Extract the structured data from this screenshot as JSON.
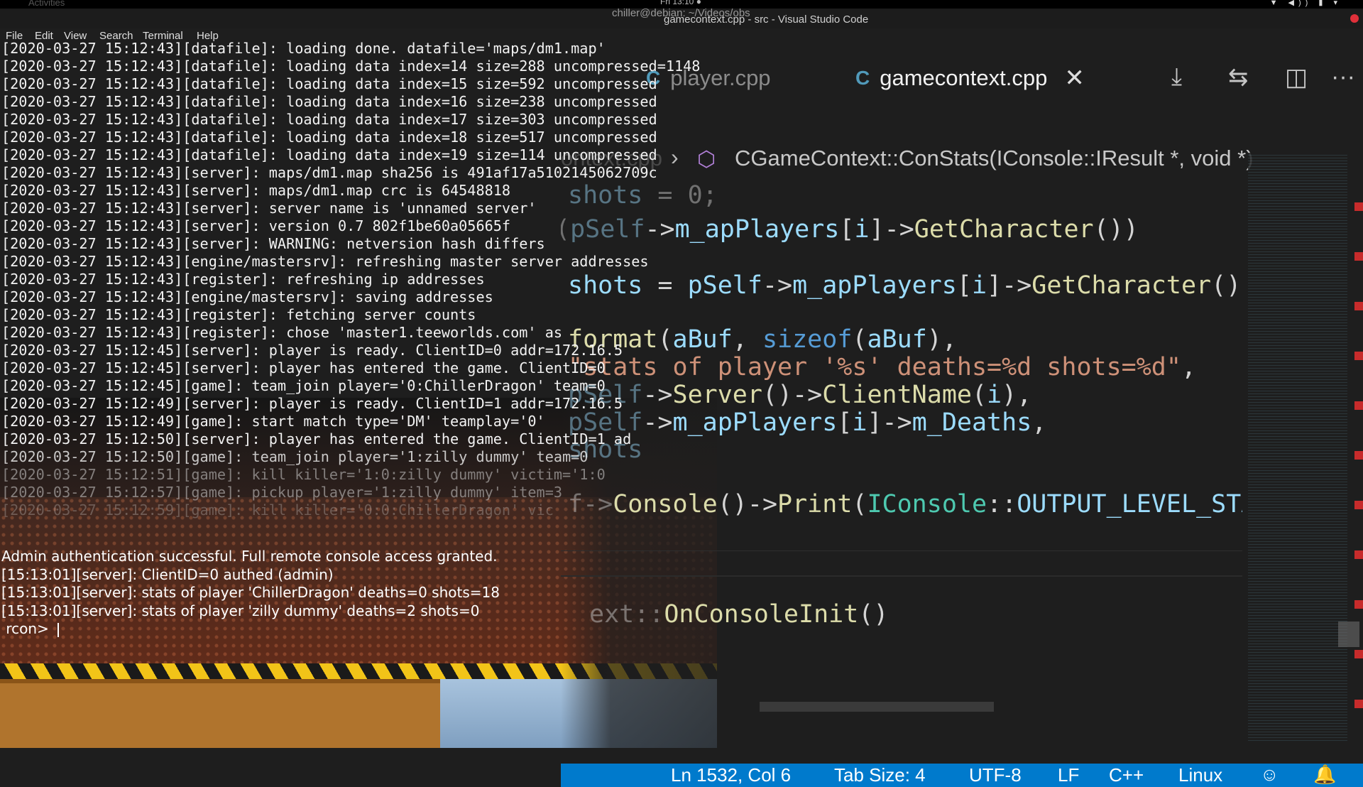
{
  "system_bar": {
    "activities": "Activities",
    "clock": "Fri 13:10 ●",
    "tray": "▼ ◀)) ▮ ▾"
  },
  "terminal": {
    "title": "chiller@debian: ~/Videos/obs",
    "menu": [
      "File",
      "Edit",
      "View",
      "Search",
      "Terminal",
      "Help"
    ],
    "log": [
      "[2020-03-27 15:12:43][datafile]: loading done. datafile='maps/dm1.map'",
      "[2020-03-27 15:12:43][datafile]: loading data index=14 size=288 uncompressed=1148",
      "[2020-03-27 15:12:43][datafile]: loading data index=15 size=592 uncompressed",
      "[2020-03-27 15:12:43][datafile]: loading data index=16 size=238 uncompressed",
      "[2020-03-27 15:12:43][datafile]: loading data index=17 size=303 uncompressed",
      "[2020-03-27 15:12:43][datafile]: loading data index=18 size=517 uncompressed",
      "[2020-03-27 15:12:43][datafile]: loading data index=19 size=114 uncompressed",
      "[2020-03-27 15:12:43][server]: maps/dm1.map sha256 is 491af17a5102145062709c",
      "[2020-03-27 15:12:43][server]: maps/dm1.map crc is 64548818",
      "[2020-03-27 15:12:43][server]: server name is 'unnamed server'",
      "[2020-03-27 15:12:43][server]: version 0.7 802f1be60a05665f",
      "[2020-03-27 15:12:43][server]: WARNING: netversion hash differs",
      "[2020-03-27 15:12:43][engine/mastersrv]: refreshing master server addresses",
      "[2020-03-27 15:12:43][register]: refreshing ip addresses",
      "[2020-03-27 15:12:43][engine/mastersrv]: saving addresses",
      "[2020-03-27 15:12:43][register]: fetching server counts",
      "[2020-03-27 15:12:43][register]: chose 'master1.teeworlds.com' as",
      "[2020-03-27 15:12:45][server]: player is ready. ClientID=0 addr=172.16.5",
      "[2020-03-27 15:12:45][server]: player has entered the game. ClientID=0",
      "[2020-03-27 15:12:45][game]: team_join player='0:ChillerDragon' team=0",
      "[2020-03-27 15:12:49][server]: player is ready. ClientID=1 addr=172.16.5",
      "[2020-03-27 15:12:49][game]: start match type='DM' teamplay='0'",
      "[2020-03-27 15:12:50][server]: player has entered the game. ClientID=1 ad",
      "[2020-03-27 15:12:50][game]: team_join player='1:zilly dummy' team=0",
      "[2020-03-27 15:12:51][game]: kill killer='1:0:zilly dummy' victim='1:0",
      "[2020-03-27 15:12:57][game]: pickup player='1:zilly dummy' item=3",
      "[2020-03-27 15:12:59][game]: kill killer='0:0:ChillerDragon' vic"
    ],
    "rcon": [
      "Admin authentication successful. Full remote console access granted.",
      "[15:13:01][server]: ClientID=0 authed (admin)",
      "[15:13:01][server]: stats of player 'ChillerDragon' deaths=0 shots=18",
      "[15:13:01][server]: stats of player 'zilly dummy' deaths=2 shots=0"
    ],
    "rcon_prompt": " rcon> "
  },
  "vscode": {
    "title": "gamecontext.cpp - src - Visual Studio Code",
    "tabs": [
      {
        "label": "player.cpp",
        "icon": "cpp-icon",
        "active": false
      },
      {
        "label": "gamecontext.cpp",
        "icon": "cpp-icon",
        "active": true
      }
    ],
    "cpp_icon_glyph": "C",
    "tab_close_glyph": "✕",
    "actions": [
      "open-changes-icon",
      "git-compare-icon",
      "split-editor-icon",
      "more-actions-icon"
    ],
    "action_glyphs": [
      "⤓",
      "⇆",
      "◫",
      "···"
    ],
    "breadcrumb": {
      "file": "ontext.cpp",
      "separator": "›",
      "symbol_icon": "⬡",
      "symbol": "CGameContext::ConStats(IConsole::IResult *, void *)"
    },
    "code": {
      "l1_var": "shots",
      "l1_rest": " = 0;",
      "l2_open": "(",
      "l2_obj": "pSelf",
      "l2_arrow": "->",
      "l2_member": "m_apPlayers",
      "l2_idx_open": "[",
      "l2_idx": "i",
      "l2_idx_close": "]->",
      "l2_fn": "GetCharacter",
      "l2_close": "())",
      "l3_var": "shots",
      "l3_eq": " = ",
      "l3_obj": "pSelf",
      "l3_arrow": "->",
      "l3_member": "m_apPlayers",
      "l3_idx_open": "[",
      "l3_idx": "i",
      "l3_idx_close": "]->",
      "l3_fn": "GetCharacter",
      "l3_close": "()",
      "l4_fn": "format",
      "l4_open": "(",
      "l4_arg1": "aBuf",
      "l4_sep": ", ",
      "l4_kw": "sizeof",
      "l4_open2": "(",
      "l4_arg2": "aBuf",
      "l4_close": "),",
      "l5_str": "\"stats of player '%s' deaths=%d shots=%d\"",
      "l5_comma": ",",
      "l6_obj": "pSelf",
      "l6_arrow": "->",
      "l6_fn": "Server",
      "l6_mid": "()->",
      "l6_fn2": "ClientName",
      "l6_open": "(",
      "l6_arg": "i",
      "l6_close": "),",
      "l7_obj": "pSelf",
      "l7_arrow": "->",
      "l7_member": "m_apPlayers",
      "l7_idx_open": "[",
      "l7_idx": "i",
      "l7_idx_close": "]->",
      "l7_member2": "m_Deaths",
      "l7_comma": ",",
      "l8_var": "shots",
      "l9_prefix": "f->",
      "l9_fn": "Console",
      "l9_mid": "()->",
      "l9_fn2": "Print",
      "l9_open": "(",
      "l9_type": "IConsole",
      "l9_scope": "::",
      "l9_const": "OUTPUT_LEVEL_STA",
      "l10_prefix": "ext::",
      "l10_fn": "OnConsoleInit",
      "l10_close": "()"
    },
    "status": {
      "position": "Ln 1532, Col 6",
      "tab_size": "Tab Size: 4",
      "encoding": "UTF-8",
      "eol": "LF",
      "language": "C++",
      "os": "Linux",
      "feedback_icon": "feedback-icon",
      "bell_icon": "bell-icon",
      "feedback_glyph": "☺",
      "bell_glyph": "🔔"
    },
    "colors": {
      "status_bar": "#007acc",
      "variable": "#9cdcfe",
      "function": "#dcdcaa",
      "string": "#ce9178",
      "type": "#4ec9b0",
      "keyword": "#569cd6"
    }
  }
}
